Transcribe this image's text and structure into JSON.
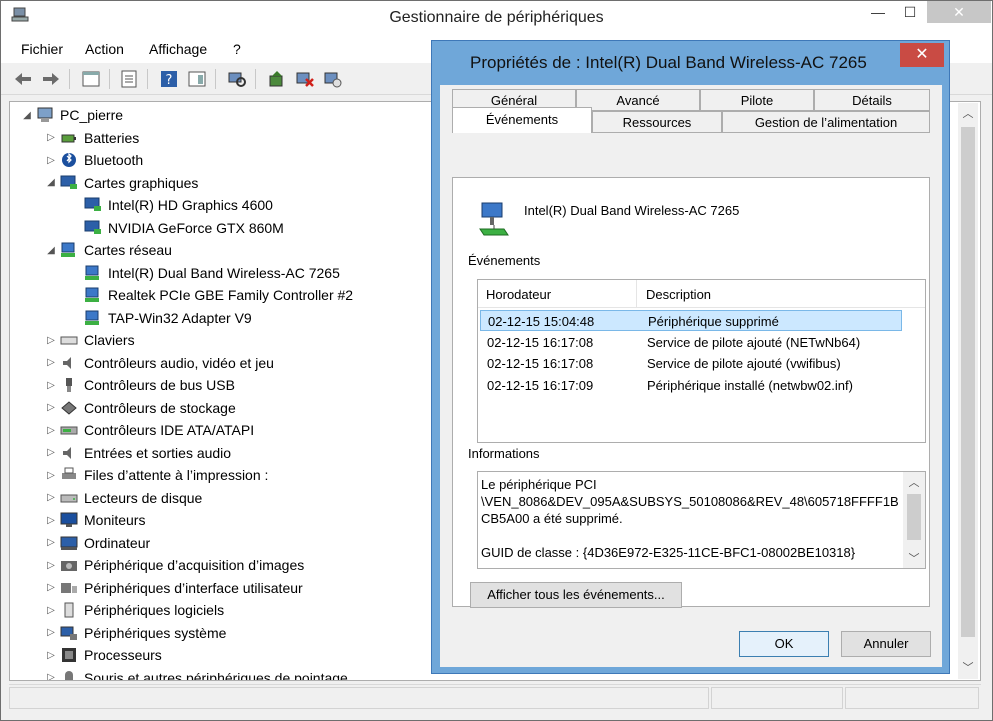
{
  "window": {
    "title": "Gestionnaire de périphériques",
    "controls": {
      "minimize": "—",
      "maximize": "☐",
      "close": "✕"
    }
  },
  "menu": [
    "Fichier",
    "Action",
    "Affichage",
    "?"
  ],
  "tree": {
    "root": "PC_pierre",
    "items": [
      {
        "label": "Batteries",
        "expander": "▷",
        "icon": "battery-icon"
      },
      {
        "label": "Bluetooth",
        "expander": "▷",
        "icon": "bluetooth-icon"
      },
      {
        "label": "Cartes graphiques",
        "expander": "◢",
        "icon": "display-adapter-icon"
      },
      {
        "label": "Intel(R) HD Graphics 4600",
        "expander": "",
        "icon": "display-adapter-icon"
      },
      {
        "label": "NVIDIA GeForce GTX 860M",
        "expander": "",
        "icon": "display-adapter-icon"
      },
      {
        "label": "Cartes réseau",
        "expander": "◢",
        "icon": "network-adapter-icon"
      },
      {
        "label": "Intel(R) Dual Band Wireless-AC 7265",
        "expander": "",
        "icon": "network-adapter-icon"
      },
      {
        "label": "Realtek PCIe GBE Family Controller #2",
        "expander": "",
        "icon": "network-adapter-icon"
      },
      {
        "label": "TAP-Win32 Adapter V9",
        "expander": "",
        "icon": "network-adapter-icon"
      },
      {
        "label": "Claviers",
        "expander": "▷",
        "icon": "keyboard-icon"
      },
      {
        "label": "Contrôleurs audio, vidéo et jeu",
        "expander": "▷",
        "icon": "speaker-icon"
      },
      {
        "label": "Contrôleurs de bus USB",
        "expander": "▷",
        "icon": "usb-icon"
      },
      {
        "label": "Contrôleurs de stockage",
        "expander": "▷",
        "icon": "storage-controller-icon"
      },
      {
        "label": "Contrôleurs IDE ATA/ATAPI",
        "expander": "▷",
        "icon": "ide-icon"
      },
      {
        "label": "Entrées et sorties audio",
        "expander": "▷",
        "icon": "speaker-icon"
      },
      {
        "label": "Files d’attente à l’impression :",
        "expander": "▷",
        "icon": "printer-icon"
      },
      {
        "label": "Lecteurs de disque",
        "expander": "▷",
        "icon": "disk-drive-icon"
      },
      {
        "label": "Moniteurs",
        "expander": "▷",
        "icon": "monitor-icon"
      },
      {
        "label": "Ordinateur",
        "expander": "▷",
        "icon": "computer-icon"
      },
      {
        "label": "Périphérique d’acquisition d’images",
        "expander": "▷",
        "icon": "camera-icon"
      },
      {
        "label": "Périphériques d’interface utilisateur",
        "expander": "▷",
        "icon": "hid-icon"
      },
      {
        "label": "Périphériques logiciels",
        "expander": "▷",
        "icon": "software-device-icon"
      },
      {
        "label": "Périphériques système",
        "expander": "▷",
        "icon": "system-device-icon"
      },
      {
        "label": "Processeurs",
        "expander": "▷",
        "icon": "processor-icon"
      },
      {
        "label": "Souris et autres périphériques de pointage",
        "expander": "▷",
        "icon": "mouse-icon"
      }
    ]
  },
  "dialog": {
    "title": "Propriétés de : Intel(R) Dual Band Wireless-AC 7265",
    "close": "✕",
    "tabs_row1": [
      "Général",
      "Avancé",
      "Pilote",
      "Détails"
    ],
    "tabs_row2": [
      "Événements",
      "Ressources",
      "Gestion de l’alimentation"
    ],
    "active_tab": "Événements",
    "device_name": "Intel(R) Dual Band Wireless-AC 7265",
    "events_label": "Événements",
    "columns": [
      "Horodateur",
      "Description"
    ],
    "events": [
      {
        "time": "02-12-15 15:04:48",
        "desc": "Périphérique supprimé"
      },
      {
        "time": "02-12-15 16:17:08",
        "desc": "Service de pilote ajouté (NETwNb64)"
      },
      {
        "time": "02-12-15 16:17:08",
        "desc": "Service de pilote ajouté (vwifibus)"
      },
      {
        "time": "02-12-15 16:17:09",
        "desc": "Périphérique installé (netwbw02.inf)"
      }
    ],
    "info_label": "Informations",
    "info_text": "Le périphérique PCI\n\\VEN_8086&DEV_095A&SUBSYS_50108086&REV_48\\605718FFFF1BCB5A00 a été supprimé.\n\nGUID de classe : {4D36E972-E325-11CE-BFC1-08002BE10318}",
    "show_all_button": "Afficher tous les événements...",
    "ok_button": "OK",
    "cancel_button": "Annuler"
  }
}
